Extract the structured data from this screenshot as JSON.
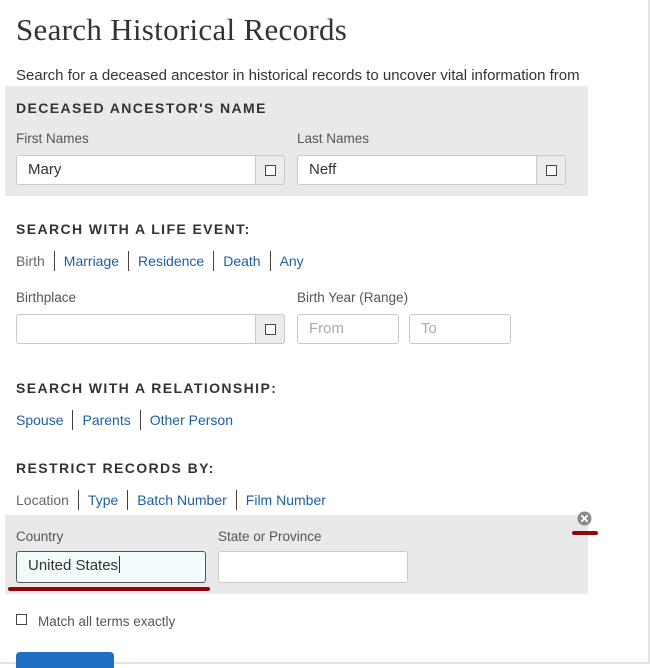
{
  "page": {
    "title": "Search Historical Records",
    "intro": "Search for a deceased ancestor in historical records to uncover vital information from"
  },
  "name_section": {
    "heading": "DECEASED ANCESTOR'S NAME",
    "first_names_label": "First Names",
    "first_names_value": "Mary",
    "last_names_label": "Last Names",
    "last_names_value": "Neff"
  },
  "life_event": {
    "heading": "SEARCH WITH A LIFE EVENT:",
    "tabs": [
      "Birth",
      "Marriage",
      "Residence",
      "Death",
      "Any"
    ],
    "selected_tab": "Birth",
    "birthplace_label": "Birthplace",
    "birthplace_value": "",
    "birth_year_label": "Birth Year (Range)",
    "from_placeholder": "From",
    "to_placeholder": "To"
  },
  "relationship": {
    "heading": "SEARCH WITH A RELATIONSHIP:",
    "tabs": [
      "Spouse",
      "Parents",
      "Other Person"
    ]
  },
  "restrict": {
    "heading": "RESTRICT RECORDS BY:",
    "tabs": [
      "Location",
      "Type",
      "Batch Number",
      "Film Number"
    ],
    "selected_tab": "Location",
    "country_label": "Country",
    "country_value": "United States",
    "state_label": "State or Province",
    "state_value": ""
  },
  "options": {
    "match_exact_label": "Match all terms exactly",
    "match_exact_checked": false
  },
  "icons": {
    "close": "close-circle-icon",
    "checkbox": "checkbox-icon"
  },
  "colors": {
    "link": "#1d5fa0",
    "panel": "#e9e9e9",
    "annotation": "#8b0a0a",
    "primary_button": "#1f6fc5"
  }
}
